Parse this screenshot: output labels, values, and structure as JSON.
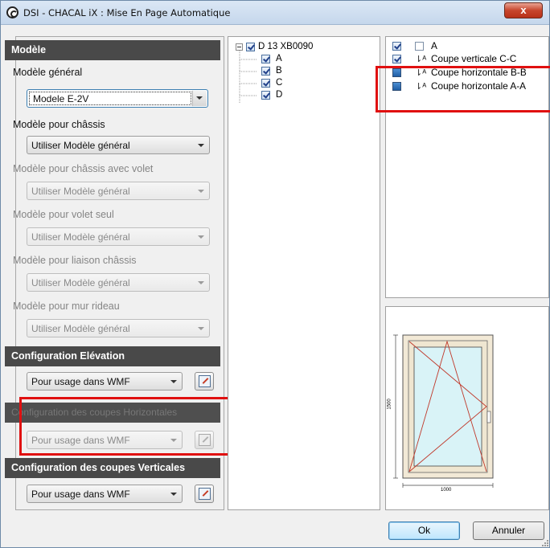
{
  "window": {
    "title": "DSI - CHACAL iX : Mise En Page Automatique",
    "close_label": "x"
  },
  "left": {
    "section_modele": "Modèle",
    "modele_general_label": "Modèle général",
    "modele_general_value": "Modele E-2V",
    "chassis_label": "Modèle pour châssis",
    "chassis_value": "Utiliser Modèle général",
    "chassis_volet_label": "Modèle pour châssis avec volet",
    "chassis_volet_value": "Utiliser Modèle général",
    "volet_seul_label": "Modèle pour volet seul",
    "volet_seul_value": "Utiliser Modèle général",
    "liaison_label": "Modèle pour liaison châssis",
    "liaison_value": "Utiliser Modèle général",
    "mur_rideau_label": "Modèle pour mur rideau",
    "mur_rideau_value": "Utiliser Modèle général",
    "config_elevation_header": "Configuration Elévation",
    "config_elevation_value": "Pour usage dans WMF",
    "config_horiz_header": "Configuration des coupes Horizontales",
    "config_horiz_value": "Pour usage dans WMF",
    "config_vert_header": "Configuration des coupes Verticales",
    "config_vert_value": "Pour usage dans WMF"
  },
  "tree": {
    "root": {
      "label": "D 13 XB0090",
      "checked": true
    },
    "children": [
      {
        "label": "A",
        "checked": true
      },
      {
        "label": "B",
        "checked": true
      },
      {
        "label": "C",
        "checked": true
      },
      {
        "label": "D",
        "checked": true
      }
    ]
  },
  "views": [
    {
      "label": "A",
      "state": "checked",
      "icon": "elevation-icon"
    },
    {
      "label": "Coupe verticale C-C",
      "state": "checked",
      "icon": "section-cut-icon"
    },
    {
      "label": "Coupe horizontale B-B",
      "state": "blue",
      "icon": "section-cut-icon"
    },
    {
      "label": "Coupe horizontale A-A",
      "state": "blue",
      "icon": "section-cut-icon"
    }
  ],
  "preview": {
    "height_label": "1500",
    "width_label": "1000"
  },
  "buttons": {
    "ok": "Ok",
    "cancel": "Annuler"
  },
  "colors": {
    "highlight_frame": "#e01010",
    "header_bg": "#494949",
    "window_frame": "#f2e9d6",
    "glass": "#d9f3f7"
  }
}
